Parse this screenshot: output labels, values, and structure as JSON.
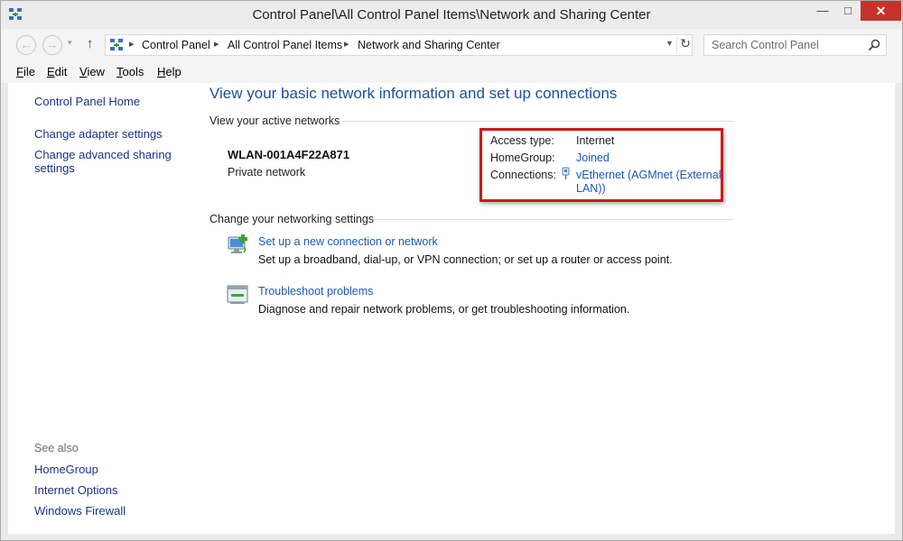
{
  "window": {
    "title": "Control Panel\\All Control Panel Items\\Network and Sharing Center",
    "minimize": "—",
    "maximize": "□",
    "close": "✕"
  },
  "nav": {
    "back": "←",
    "forward": "→",
    "recent": "▾",
    "up": "↑",
    "breadcrumbs": [
      "Control Panel",
      "All Control Panel Items",
      "Network and Sharing Center"
    ],
    "refresh": "↻",
    "search_placeholder": "Search Control Panel"
  },
  "menu": [
    "File",
    "Edit",
    "View",
    "Tools",
    "Help"
  ],
  "sidebar": {
    "links": [
      "Control Panel Home",
      "Change adapter settings",
      "Change advanced sharing settings"
    ],
    "see_also_label": "See also",
    "see_also": [
      "HomeGroup",
      "Internet Options",
      "Windows Firewall"
    ]
  },
  "main": {
    "heading": "View your basic network information and set up connections",
    "active_networks_label": "View your active networks",
    "network": {
      "name": "WLAN-001A4F22A871",
      "type": "Private network",
      "access_type_label": "Access type:",
      "access_type_value": "Internet",
      "homegroup_label": "HomeGroup:",
      "homegroup_value": "Joined",
      "connections_label": "Connections:",
      "connections_value_line1": "vEthernet (AGMnet (External",
      "connections_value_line2": "LAN))"
    },
    "change_settings_label": "Change your networking settings",
    "tasks": [
      {
        "link": "Set up a new connection or network",
        "desc": "Set up a broadband, dial-up, or VPN connection; or set up a router or access point."
      },
      {
        "link": "Troubleshoot problems",
        "desc": "Diagnose and repair network problems, or get troubleshooting information."
      }
    ]
  },
  "colors": {
    "link": "#1a58b8",
    "heading": "#1e4e9a",
    "highlight": "#d0181c",
    "close_button": "#c7312b"
  }
}
